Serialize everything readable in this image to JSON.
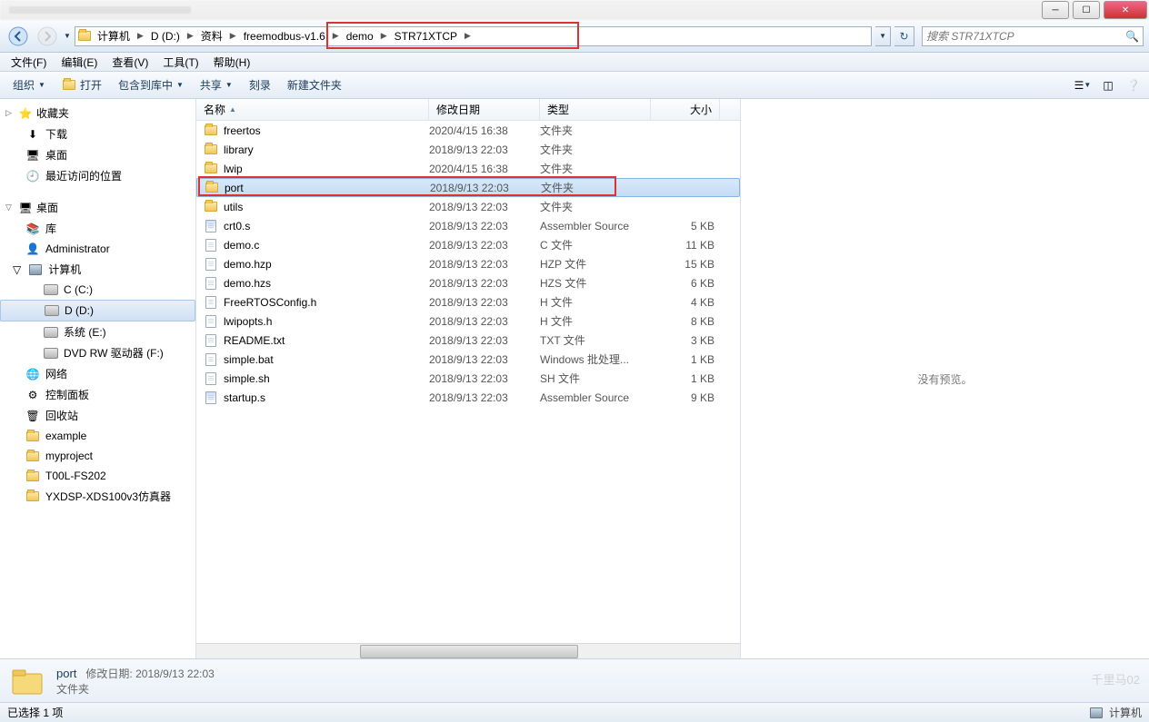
{
  "titlebar": {
    "min": "─",
    "max": "☐",
    "close": "✕"
  },
  "nav": {
    "breadcrumb": [
      "计算机",
      "D (D:)",
      "资料",
      "freemodbus-v1.6",
      "demo",
      "STR71XTCP"
    ],
    "search_placeholder": "搜索 STR71XTCP"
  },
  "menu": [
    "文件(F)",
    "编辑(E)",
    "查看(V)",
    "工具(T)",
    "帮助(H)"
  ],
  "toolbar": {
    "organize": "组织",
    "open": "打开",
    "include": "包含到库中",
    "share": "共享",
    "burn": "刻录",
    "newfolder": "新建文件夹"
  },
  "columns": {
    "name": "名称",
    "date": "修改日期",
    "type": "类型",
    "size": "大小"
  },
  "sidebar": {
    "favorites": {
      "label": "收藏夹",
      "items": [
        "下载",
        "桌面",
        "最近访问的位置"
      ]
    },
    "desktop": {
      "label": "桌面",
      "items": [
        {
          "label": "库",
          "icon": "lib"
        },
        {
          "label": "Administrator",
          "icon": "user"
        },
        {
          "label": "计算机",
          "icon": "comp",
          "children": [
            {
              "label": "C (C:)",
              "icon": "drive"
            },
            {
              "label": "D (D:)",
              "icon": "drive",
              "selected": true
            },
            {
              "label": "系统 (E:)",
              "icon": "drive"
            },
            {
              "label": "DVD RW 驱动器 (F:)",
              "icon": "dvd"
            }
          ]
        },
        {
          "label": "网络",
          "icon": "net"
        },
        {
          "label": "控制面板",
          "icon": "ctrl"
        },
        {
          "label": "回收站",
          "icon": "trash"
        },
        {
          "label": "example",
          "icon": "folder"
        },
        {
          "label": "myproject",
          "icon": "folder"
        },
        {
          "label": "T00L-FS202",
          "icon": "folder"
        },
        {
          "label": "YXDSP-XDS100v3仿真器",
          "icon": "folder"
        }
      ]
    }
  },
  "files": [
    {
      "name": "freertos",
      "date": "2020/4/15 16:38",
      "type": "文件夹",
      "size": "",
      "icon": "folder"
    },
    {
      "name": "library",
      "date": "2018/9/13 22:03",
      "type": "文件夹",
      "size": "",
      "icon": "folder"
    },
    {
      "name": "lwip",
      "date": "2020/4/15 16:38",
      "type": "文件夹",
      "size": "",
      "icon": "folder"
    },
    {
      "name": "port",
      "date": "2018/9/13 22:03",
      "type": "文件夹",
      "size": "",
      "icon": "folder",
      "selected": true,
      "highlighted": true
    },
    {
      "name": "utils",
      "date": "2018/9/13 22:03",
      "type": "文件夹",
      "size": "",
      "icon": "folder"
    },
    {
      "name": "crt0.s",
      "date": "2018/9/13 22:03",
      "type": "Assembler Source",
      "size": "5 KB",
      "icon": "asm"
    },
    {
      "name": "demo.c",
      "date": "2018/9/13 22:03",
      "type": "C 文件",
      "size": "11 KB",
      "icon": "file"
    },
    {
      "name": "demo.hzp",
      "date": "2018/9/13 22:03",
      "type": "HZP 文件",
      "size": "15 KB",
      "icon": "file"
    },
    {
      "name": "demo.hzs",
      "date": "2018/9/13 22:03",
      "type": "HZS 文件",
      "size": "6 KB",
      "icon": "file"
    },
    {
      "name": "FreeRTOSConfig.h",
      "date": "2018/9/13 22:03",
      "type": "H 文件",
      "size": "4 KB",
      "icon": "file"
    },
    {
      "name": "lwipopts.h",
      "date": "2018/9/13 22:03",
      "type": "H 文件",
      "size": "8 KB",
      "icon": "file"
    },
    {
      "name": "README.txt",
      "date": "2018/9/13 22:03",
      "type": "TXT 文件",
      "size": "3 KB",
      "icon": "txt"
    },
    {
      "name": "simple.bat",
      "date": "2018/9/13 22:03",
      "type": "Windows 批处理...",
      "size": "1 KB",
      "icon": "file"
    },
    {
      "name": "simple.sh",
      "date": "2018/9/13 22:03",
      "type": "SH 文件",
      "size": "1 KB",
      "icon": "file"
    },
    {
      "name": "startup.s",
      "date": "2018/9/13 22:03",
      "type": "Assembler Source",
      "size": "9 KB",
      "icon": "asm"
    }
  ],
  "preview": {
    "empty": "没有预览。"
  },
  "details": {
    "name": "port",
    "date_label": "修改日期:",
    "date": "2018/9/13 22:03",
    "type": "文件夹"
  },
  "status": {
    "text": "已选择 1 项",
    "computer": "计算机"
  },
  "watermark": "千里马02"
}
